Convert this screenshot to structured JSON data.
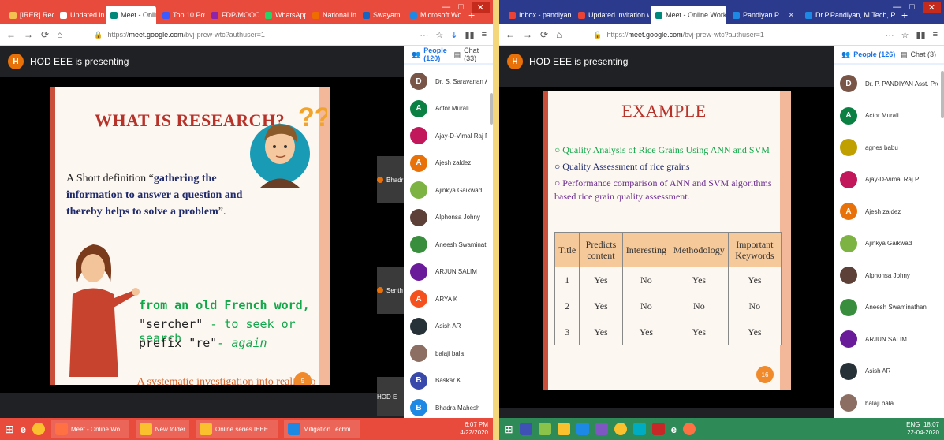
{
  "left": {
    "tabs": [
      {
        "label": "[IRER] Request t",
        "color": "#f4c150",
        "active": false
      },
      {
        "label": "Updated invitatio",
        "color": "#ffffff",
        "active": false
      },
      {
        "label": "Meet - Online",
        "color": "#00897b",
        "active": true
      },
      {
        "label": "Top 10 Power",
        "color": "#3d5afe",
        "active": false
      },
      {
        "label": "FDP/MOOC/IT Pr",
        "color": "#8e24aa",
        "active": false
      },
      {
        "label": "WhatsApp",
        "color": "#25d366",
        "active": false
      },
      {
        "label": "National Instituti",
        "color": "#ef6c00",
        "active": false
      },
      {
        "label": "Swayam",
        "color": "#1565c0",
        "active": false
      },
      {
        "label": "Microsoft Word - Seq",
        "color": "#1e88e5",
        "active": false
      }
    ],
    "url_prefix": "https://",
    "url_host": "meet.google.com",
    "url_path": "/bvj-prew-wtc?authuser=1",
    "presenting": "HOD EEE is presenting",
    "presenter_initial": "H",
    "people_label": "People (120)",
    "chat_label": "Chat (33)",
    "slide": {
      "title": "WHAT IS RESEARCH?",
      "def_prefix": "A Short definition “",
      "def_bold": "gathering the information to answer a question and thereby helps to solve a problem",
      "def_suffix": "”.",
      "french_1": "from an old French word,",
      "french_2a": "\"sercher\"",
      "french_2b": " - to seek or search",
      "french_3a": "prefix \"re\"",
      "french_3b": "- again",
      "systematic": "A systematic investigation into reality to gain knowledge.",
      "page": "5",
      "question": "??"
    },
    "thumbs": [
      "Bhadr",
      "Senth",
      "HOD E"
    ],
    "participants": [
      {
        "name": "Dr. S. Saravanan Asst Prof EEE...",
        "initial": "D",
        "color": "#795548"
      },
      {
        "name": "Actor Murali",
        "initial": "A",
        "color": "#0b8043"
      },
      {
        "name": "Ajay-D-Vimal Raj P",
        "initial": "",
        "color": "#c2185b"
      },
      {
        "name": "Ajesh zaldez",
        "initial": "A",
        "color": "#e8710a"
      },
      {
        "name": "Ajinkya Gaikwad",
        "initial": "",
        "color": "#7cb342"
      },
      {
        "name": "Alphonsa Johny",
        "initial": "",
        "color": "#5d4037"
      },
      {
        "name": "Aneesh Swaminathan",
        "initial": "",
        "color": "#388e3c"
      },
      {
        "name": "ARJUN SALIM",
        "initial": "",
        "color": "#6a1b9a"
      },
      {
        "name": "ARYA K",
        "initial": "A",
        "color": "#f4511e"
      },
      {
        "name": "Asish AR",
        "initial": "",
        "color": "#263238"
      },
      {
        "name": "balaji bala",
        "initial": "",
        "color": "#8d6e63"
      },
      {
        "name": "Baskar K",
        "initial": "B",
        "color": "#3949ab"
      },
      {
        "name": "Bhadra Mahesh",
        "initial": "B",
        "color": "#1e88e5"
      }
    ],
    "taskbar": [
      {
        "label": "Meet - Online Wo...",
        "color": "#ff7043"
      },
      {
        "label": "New folder",
        "color": "#fbc02d"
      },
      {
        "label": "Online series IEEE...",
        "color": "#fbc02d"
      },
      {
        "label": "Mitigation Techni...",
        "color": "#1e88e5"
      }
    ],
    "time": "6:07 PM",
    "date": "4/22/2020"
  },
  "right": {
    "tabs": [
      {
        "label": "Inbox - pandiyan@gmail.com",
        "color": "#ea4335",
        "active": false
      },
      {
        "label": "Updated invitation with note",
        "color": "#ea4335",
        "active": false
      },
      {
        "label": "Meet - Online Workshop o",
        "color": "#00897b",
        "active": true
      },
      {
        "label": "Pandiyan P",
        "color": "#1e88e5",
        "active": false
      },
      {
        "label": "Dr.P.Pandiyan, M.Tech, Ph.D.,",
        "color": "#1e88e5",
        "active": false
      }
    ],
    "url_prefix": "https://",
    "url_host": "meet.google.com",
    "url_path": "/bvj-prew-wtc?authuser=1",
    "presenting": "HOD EEE is presenting",
    "presenter_initial": "H",
    "people_label": "People (126)",
    "chat_label": "Chat (3)",
    "slide": {
      "title": "EXAMPLE",
      "bullets": [
        "Quality Analysis of Rice Grains Using ANN and SVM",
        "Quality Assessment of rice grains",
        "Performance comparison of ANN and SVM algorithms based rice grain quality assessment."
      ],
      "table_header": [
        "Title",
        "Predicts content",
        "Interesting",
        "Methodology",
        "Important Keywords"
      ],
      "table_rows": [
        [
          "1",
          "Yes",
          "No",
          "Yes",
          "Yes"
        ],
        [
          "2",
          "Yes",
          "No",
          "No",
          "No"
        ],
        [
          "3",
          "Yes",
          "Yes",
          "Yes",
          "Yes"
        ]
      ],
      "page": "16"
    },
    "participants": [
      {
        "name": "Dr. P. PANDIYAN Asst. Prof. EE...",
        "initial": "D",
        "color": "#795548"
      },
      {
        "name": "Actor Murali",
        "initial": "A",
        "color": "#0b8043"
      },
      {
        "name": "agnes babu",
        "initial": "",
        "color": "#c0a000"
      },
      {
        "name": "Ajay-D-Vimal Raj P",
        "initial": "",
        "color": "#c2185b"
      },
      {
        "name": "Ajesh zaldez",
        "initial": "A",
        "color": "#e8710a"
      },
      {
        "name": "Ajinkya Gaikwad",
        "initial": "",
        "color": "#7cb342"
      },
      {
        "name": "Alphonsa Johny",
        "initial": "",
        "color": "#5d4037"
      },
      {
        "name": "Aneesh Swaminathan",
        "initial": "",
        "color": "#388e3c"
      },
      {
        "name": "ARJUN SALIM",
        "initial": "",
        "color": "#6a1b9a"
      },
      {
        "name": "Asish AR",
        "initial": "",
        "color": "#263238"
      },
      {
        "name": "balaji bala",
        "initial": "",
        "color": "#8d6e63"
      }
    ],
    "tray_lang": "ENG",
    "time": "18:07",
    "date": "22-04-2020"
  }
}
